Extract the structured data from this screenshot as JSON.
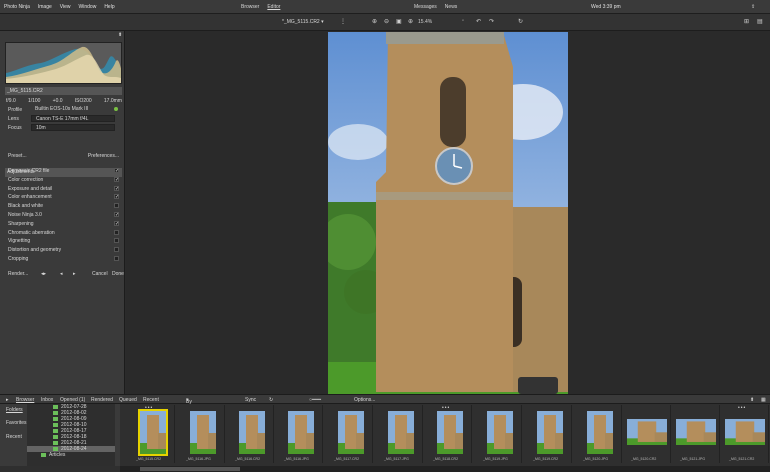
{
  "menu": {
    "app": "Photo Ninja",
    "image": "Image",
    "view": "View",
    "window": "Window",
    "help": "Help",
    "browser": "Browser",
    "editor": "Editor",
    "messages": "Messages",
    "news": "News",
    "datetime": "Wed 3:39 pm"
  },
  "toolbar": {
    "filename": "*_MG_5115.CR2",
    "zoom": "15.4%"
  },
  "left": {
    "file_label": "_MG_5115.CR2",
    "exif": [
      "f/9.0",
      "1/100",
      "+0.0",
      "ISO200",
      "17.0mm"
    ],
    "profile_label": "Profile",
    "profile_value": "Builtin EOS-10s Mark III",
    "lens_label": "Lens",
    "lens_value": "Canon TS-E 17mm f/4L",
    "focus_label": "Focus",
    "focus_value": "10m",
    "adjustments_header": "Adjustments",
    "preset": "Preset...",
    "preferences": "Preferences...",
    "items": [
      {
        "label": "Demosaic CR2 file",
        "checked": true
      },
      {
        "label": "Color correction",
        "checked": true
      },
      {
        "label": "Exposure and detail",
        "checked": true
      },
      {
        "label": "Color enhancement",
        "checked": true
      },
      {
        "label": "Black and white",
        "checked": false
      },
      {
        "label": "Noise Ninja 3.0",
        "checked": true
      },
      {
        "label": "Sharpening",
        "checked": true
      },
      {
        "label": "Chromatic aberration",
        "checked": false
      },
      {
        "label": "Vignetting",
        "checked": false
      },
      {
        "label": "Distortion and geometry",
        "checked": false
      },
      {
        "label": "Cropping",
        "checked": false
      }
    ],
    "render": "Render...",
    "cancel": "Cancel",
    "done": "Done"
  },
  "tabs": {
    "browser": "Browser",
    "inbox": "Inbox",
    "opened": "Opened (1)",
    "rendered": "Rendered",
    "queued": "Queued",
    "recent": "Recent",
    "sort": "By name",
    "sync": "Sync",
    "options": "Options..."
  },
  "folders": {
    "folders_label": "Folders",
    "favorites_label": "Favorites",
    "recent_label": "Recent",
    "items": [
      "2012-07-28",
      "2012-08-02",
      "2012-08-09",
      "2012-08-10",
      "2012-08-17",
      "2012-08-18",
      "2012-08-21",
      "2012-08-24"
    ],
    "bottom": "Articles"
  },
  "thumbs": [
    "_MG_5115.CR2",
    "_MG_5116.JPG",
    "_MG_5116.CR2",
    "_MG_5116.JPG",
    "_MG_5117.CR2",
    "_MG_5117.JPG",
    "_MG_5118.CR2",
    "_MG_5119.JPG",
    "_MG_5119.CR2",
    "_MG_5120.JPG",
    "_MG_5120.CR2",
    "_MG_5121.JPG",
    "_MG_5121.CR2"
  ]
}
